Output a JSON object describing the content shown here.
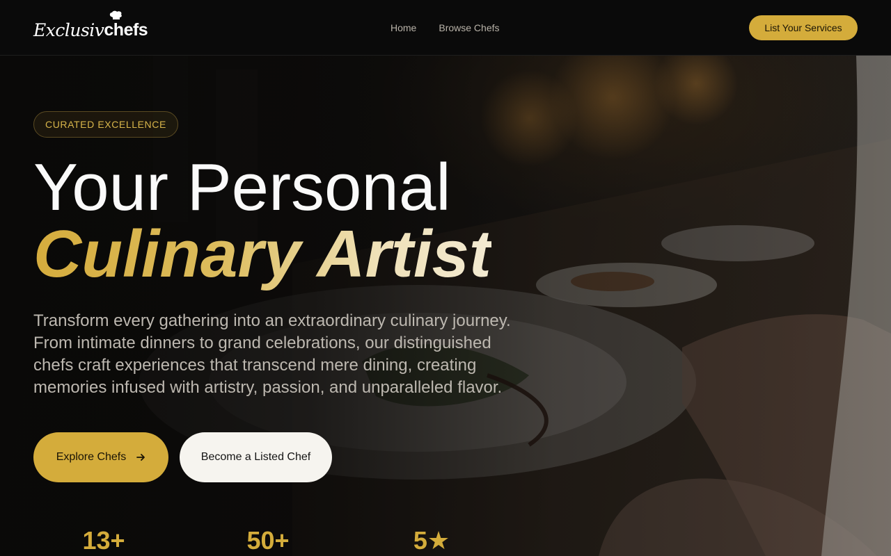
{
  "header": {
    "logo_script": "Exclusiv",
    "logo_bold": "chefs",
    "nav": [
      {
        "label": "Home"
      },
      {
        "label": "Browse Chefs"
      }
    ],
    "cta_label": "List Your Services"
  },
  "hero": {
    "badge": "CURATED EXCELLENCE",
    "title_line1": "Your Personal",
    "title_line2": "Culinary Artist",
    "lead": "Transform every gathering into an extraordinary culinary journey. From intimate dinners to grand celebrations, our distinguished chefs craft experiences that transcend mere dining, creating memories infused with artistry, passion, and unparalleled flavor.",
    "primary_button": "Explore Chefs",
    "secondary_button": "Become a Listed Chef"
  },
  "stats": [
    {
      "value": "13+"
    },
    {
      "value": "50+"
    },
    {
      "value": "5★"
    }
  ],
  "colors": {
    "accent": "#d4ac3b",
    "background": "#0a0a0a",
    "text_muted": "#b8b2a8"
  },
  "icons": {
    "primary_button_icon": "arrow-right-icon",
    "logo_icon": "chef-hat-icon"
  }
}
